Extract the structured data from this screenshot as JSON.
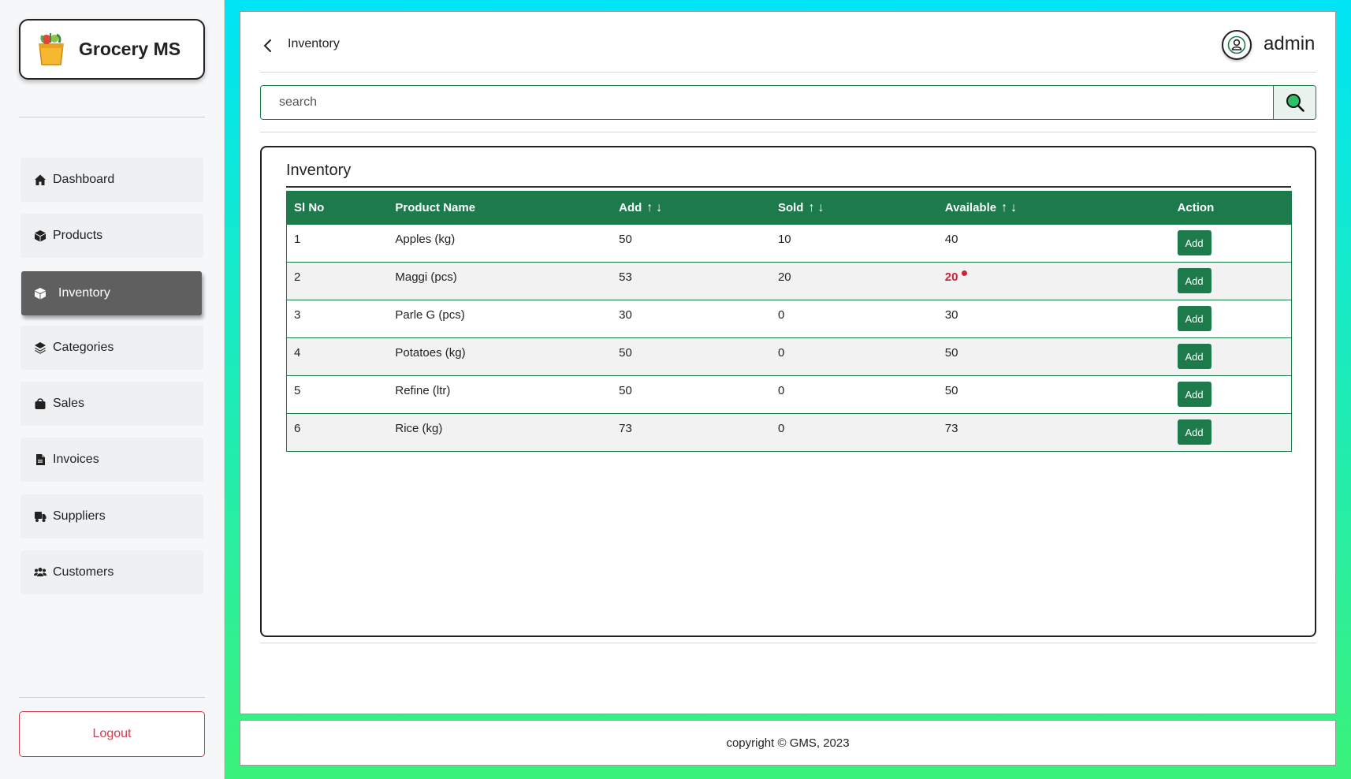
{
  "brand": {
    "name": "Grocery MS"
  },
  "sidebar": {
    "items": [
      {
        "label": "Dashboard",
        "icon": "home-icon"
      },
      {
        "label": "Products",
        "icon": "box-icon"
      },
      {
        "label": "Inventory",
        "icon": "box-icon",
        "active": true
      },
      {
        "label": "Categories",
        "icon": "layers-icon"
      },
      {
        "label": "Sales",
        "icon": "bag-icon"
      },
      {
        "label": "Invoices",
        "icon": "file-icon"
      },
      {
        "label": "Suppliers",
        "icon": "truck-icon"
      },
      {
        "label": "Customers",
        "icon": "users-icon"
      }
    ],
    "logout_label": "Logout"
  },
  "header": {
    "title": "Inventory",
    "user": "admin"
  },
  "search": {
    "placeholder": "search"
  },
  "inventory": {
    "title": "Inventory",
    "columns": [
      "Sl No",
      "Product Name",
      "Add",
      "Sold",
      "Available",
      "Action"
    ],
    "sort_arrows": "↑↓",
    "action_label": "Add",
    "rows": [
      {
        "sl": "1",
        "name": "Apples (kg)",
        "add": "50",
        "sold": "10",
        "available": "40",
        "low": false
      },
      {
        "sl": "2",
        "name": "Maggi (pcs)",
        "add": "53",
        "sold": "20",
        "available": "20",
        "low": true
      },
      {
        "sl": "3",
        "name": "Parle G (pcs)",
        "add": "30",
        "sold": "0",
        "available": "30",
        "low": false
      },
      {
        "sl": "4",
        "name": "Potatoes (kg)",
        "add": "50",
        "sold": "0",
        "available": "50",
        "low": false
      },
      {
        "sl": "5",
        "name": "Refine (ltr)",
        "add": "50",
        "sold": "0",
        "available": "50",
        "low": false
      },
      {
        "sl": "6",
        "name": "Rice (kg)",
        "add": "73",
        "sold": "0",
        "available": "73",
        "low": false
      }
    ]
  },
  "footer": {
    "text": "copyright © GMS, 2023"
  },
  "colors": {
    "accent": "#1c7a4b",
    "danger": "#d0203a",
    "active_nav": "#5f5f5f"
  }
}
